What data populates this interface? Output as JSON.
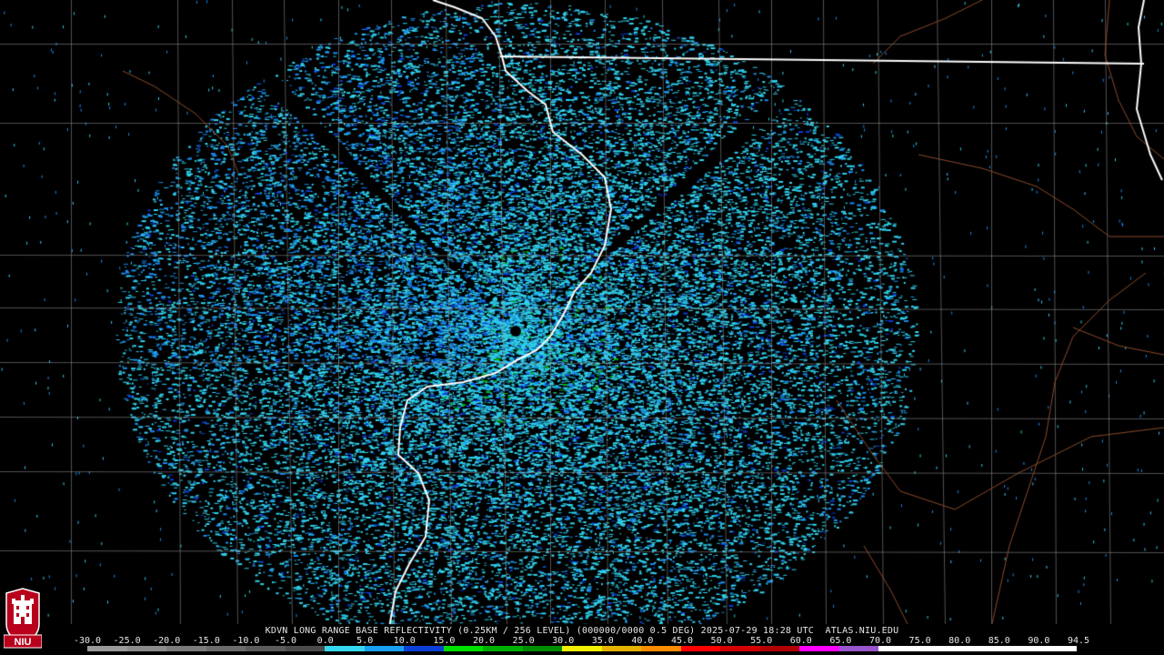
{
  "product": {
    "caption": "KDVN LONG RANGE BASE REFLECTIVITY (0.25KM / 256 LEVEL) (000000/0000 0.5 DEG) 2025-07-29 18:28 UTC  ATLAS.NIU.EDU",
    "station": "KDVN",
    "product_name": "LONG RANGE BASE REFLECTIVITY",
    "resolution": "0.25KM / 256 LEVEL",
    "elevation": "0.5 DEG",
    "time": "2025-07-29 18:28 UTC",
    "source": "ATLAS.NIU.EDU"
  },
  "color_scale": {
    "labels": [
      "-30.0",
      "-25.0",
      "-20.0",
      "-15.0",
      "-10.0",
      "-5.0",
      "0.0",
      "5.0",
      "10.0",
      "15.0",
      "20.0",
      "25.0",
      "30.0",
      "35.0",
      "40.0",
      "45.0",
      "50.0",
      "55.0",
      "60.0",
      "65.0",
      "70.0",
      "75.0",
      "80.0",
      "85.0",
      "90.0",
      "94.5"
    ],
    "colors": [
      "#9a9a9a",
      "#8c8c8c",
      "#7c7c7c",
      "#6c6c6c",
      "#5c5c5c",
      "#4c4c4c",
      "#35d8ee",
      "#1aa0f0",
      "#0a40d8",
      "#00e000",
      "#00b000",
      "#008c00",
      "#f0f000",
      "#e6b400",
      "#ff8c00",
      "#ff0000",
      "#d40000",
      "#b00000",
      "#ff00ff",
      "#9955cc",
      "#ffffff",
      "#ffffff",
      "#ffffff",
      "#ffffff",
      "#ffffff"
    ]
  },
  "logo": {
    "text": "NIU"
  }
}
